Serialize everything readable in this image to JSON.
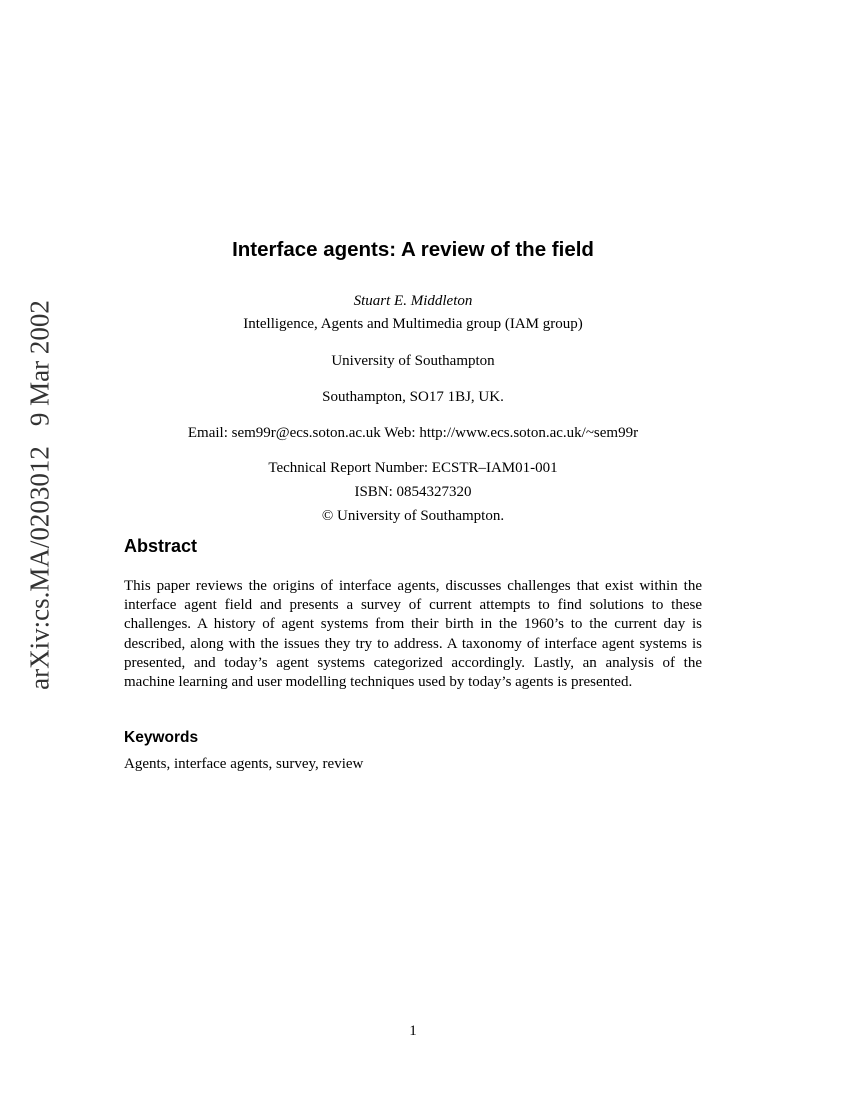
{
  "sidebar_stamp": {
    "identifier": "arXiv:cs.MA/0203012",
    "date": "9 Mar 2002"
  },
  "header": {
    "title": "Interface agents: A review of the field",
    "author": "Stuart E. Middleton",
    "affiliation": "Intelligence, Agents and Multimedia group (IAM group)",
    "university": "University of Southampton",
    "address": "Southampton, SO17 1BJ, UK.",
    "contact": "Email: sem99r@ecs.soton.ac.uk Web: http://www.ecs.soton.ac.uk/~sem99r",
    "report_number": "Technical Report Number: ECSTR–IAM01-001",
    "isbn": "ISBN: 0854327320",
    "copyright": "© University of Southampton."
  },
  "abstract": {
    "heading": "Abstract",
    "body": "This paper reviews the origins of interface agents, discusses challenges that exist within the interface agent field and presents a survey of current attempts to find solutions to these challenges. A history of agent systems from their birth in the 1960’s to the current day is described, along with the issues they try to address. A taxonomy of interface agent systems is presented, and today’s agent systems categorized accordingly. Lastly, an analysis of the machine learning and user modelling techniques used by today’s agents is presented."
  },
  "keywords": {
    "heading": "Keywords",
    "body": "Agents, interface agents, survey, review"
  },
  "footer": {
    "page_number": "1"
  }
}
